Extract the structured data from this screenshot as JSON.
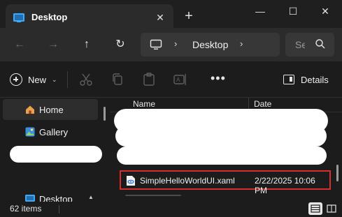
{
  "window": {
    "tab_title": "Desktop",
    "tab_close_glyph": "✕",
    "new_tab_glyph": "+",
    "minimize_glyph": "—",
    "maximize_glyph": "☐",
    "close_glyph": "✕"
  },
  "navigation": {
    "back_glyph": "←",
    "forward_glyph": "→",
    "up_glyph": "↑",
    "refresh_glyph": "↻",
    "breadcrumb_separator": "›",
    "breadcrumb": "Desktop",
    "search_placeholder": "Se"
  },
  "command_bar": {
    "new_label": "New",
    "details_label": "Details",
    "more_glyph": "•••"
  },
  "sidebar": {
    "items": [
      {
        "label": "Home",
        "icon": "home-icon",
        "selected": true
      },
      {
        "label": "Gallery",
        "icon": "gallery-icon",
        "selected": false
      },
      {
        "label": "Desktop",
        "icon": "desktop-folder-icon",
        "selected": false
      }
    ]
  },
  "file_list": {
    "columns": [
      "Name",
      "Date"
    ],
    "rows": [
      {
        "name": "SimpleHelloWorldUI.xaml",
        "date": "2/22/2025 10:06 PM",
        "icon": "xaml-file-icon",
        "highlighted": true
      }
    ]
  },
  "status_bar": {
    "item_count": "62 items"
  },
  "colors": {
    "window_bg": "#1c1c1c",
    "highlight_border": "#d32f2f",
    "accent": "#4aa3ff"
  }
}
